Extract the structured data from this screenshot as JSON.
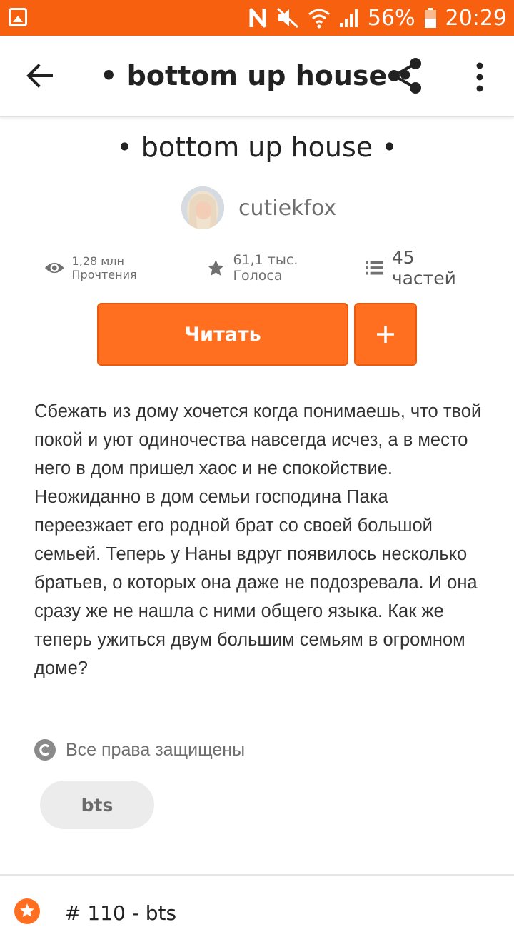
{
  "status_bar": {
    "battery_percent": "56%",
    "time": "20:29"
  },
  "app_bar": {
    "title": "• bottom up house •"
  },
  "story": {
    "title": "• bottom up house •",
    "author": "cutiekfox",
    "reads": "1,28 млн Прочтения",
    "votes": "61,1 тыс. Голоса",
    "parts": "45 частей",
    "read_button": "Читать",
    "add_button": "+",
    "description_p1": "Сбежать из дому хочется когда понимаешь, что твой покой и уют одиночества навсегда исчез, а в место него в дом пришел хаос и не спокойствие.",
    "description_p2": "Неожиданно в дом семьи господина Пака переезжает его родной брат со своей большой семьей. Теперь у Наны вдруг появилось несколько братьев, о которых она даже не подозревала. И она сразу же не нашла с ними общего языка. Как же теперь ужиться двум большим семьям в огромном доме?",
    "copyright": "Все права защищены",
    "tag": "bts",
    "ranking": "# 110 - bts"
  },
  "colors": {
    "accent": "#ff6f1f",
    "status_bar": "#f7600e"
  },
  "icons": [
    "gallery-icon",
    "nfc-icon",
    "mute-icon",
    "wifi-icon",
    "signal-icon",
    "battery-icon",
    "back-arrow-icon",
    "share-icon",
    "more-vert-icon",
    "eye-icon",
    "star-icon",
    "list-icon",
    "plus-icon",
    "copyright-icon",
    "ranking-star-icon"
  ]
}
